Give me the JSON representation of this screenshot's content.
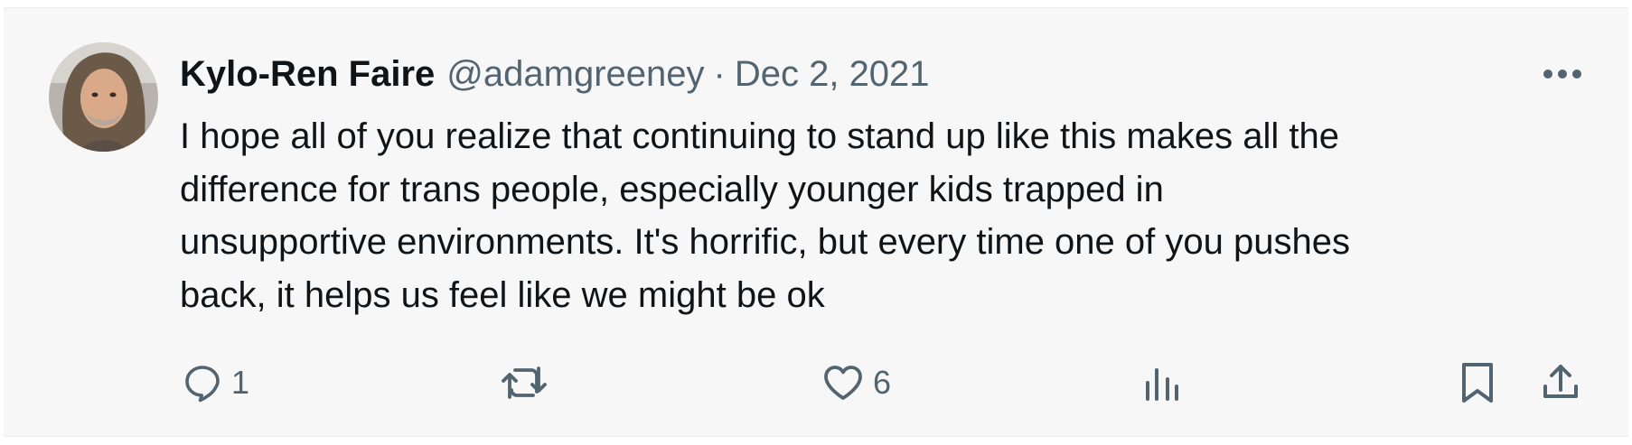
{
  "tweet": {
    "display_name": "Kylo-Ren Faire",
    "handle": "@adamgreeney",
    "separator": "·",
    "date": "Dec 2, 2021",
    "text_lines": [
      "I hope all of you realize that continuing to stand up like this makes all the",
      "difference for trans people, especially younger kids trapped in",
      "unsupportive environments. It's horrific, but every time one of you pushes",
      "back, it helps us feel like we might be ok"
    ]
  },
  "actions": {
    "reply": {
      "icon": "reply-icon",
      "count": "1"
    },
    "retweet": {
      "icon": "retweet-icon",
      "count": ""
    },
    "like": {
      "icon": "heart-icon",
      "count": "6"
    },
    "views": {
      "icon": "views-icon",
      "count": ""
    },
    "bookmark": {
      "icon": "bookmark-icon"
    },
    "share": {
      "icon": "share-icon"
    }
  },
  "colors": {
    "background": "#f7f7f7",
    "text_primary": "#0f1419",
    "text_secondary": "#536471"
  }
}
